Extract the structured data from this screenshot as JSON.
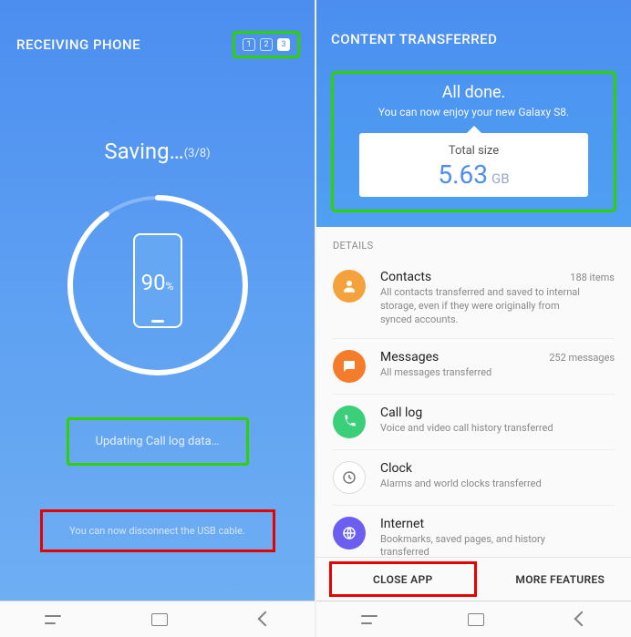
{
  "colors": {
    "brand": "#4b8ef0",
    "hl_green": "#2fd200",
    "hl_red": "#e60000"
  },
  "left": {
    "header": "RECEIVING PHONE",
    "steps": [
      "1",
      "2",
      "3"
    ],
    "active_step": 2,
    "saving_label": "Saving…",
    "saving_count": "(3/8)",
    "progress": "90",
    "progress_unit": "%",
    "status_line": "Updating Call log data…",
    "hint": "You can now disconnect the USB cable."
  },
  "right": {
    "header": "CONTENT TRANSFERRED",
    "done_title": "All done.",
    "done_sub": "You can now enjoy your new Galaxy S8.",
    "card_label": "Total size",
    "card_value": "5.63",
    "card_unit": "GB",
    "details_label": "DETAILS",
    "items": [
      {
        "icon": "contacts-icon",
        "color": "#f4a33c",
        "title": "Contacts",
        "meta": "188 items",
        "sub": "All contacts transferred and saved to internal storage, even if they were originally from synced accounts."
      },
      {
        "icon": "messages-icon",
        "color": "#f47c2a",
        "title": "Messages",
        "meta": "252 messages",
        "sub": "All messages transferred"
      },
      {
        "icon": "calllog-icon",
        "color": "#3bcf7a",
        "title": "Call log",
        "meta": "",
        "sub": "Voice and video call history transferred"
      },
      {
        "icon": "clock-icon",
        "color": "#fff",
        "title": "Clock",
        "meta": "",
        "sub": "Alarms and world clocks transferred"
      },
      {
        "icon": "internet-icon",
        "color": "#6b5ef0",
        "title": "Internet",
        "meta": "",
        "sub": "Bookmarks, saved pages, and history transferred"
      }
    ],
    "close_label": "CLOSE APP",
    "more_label": "MORE FEATURES"
  }
}
